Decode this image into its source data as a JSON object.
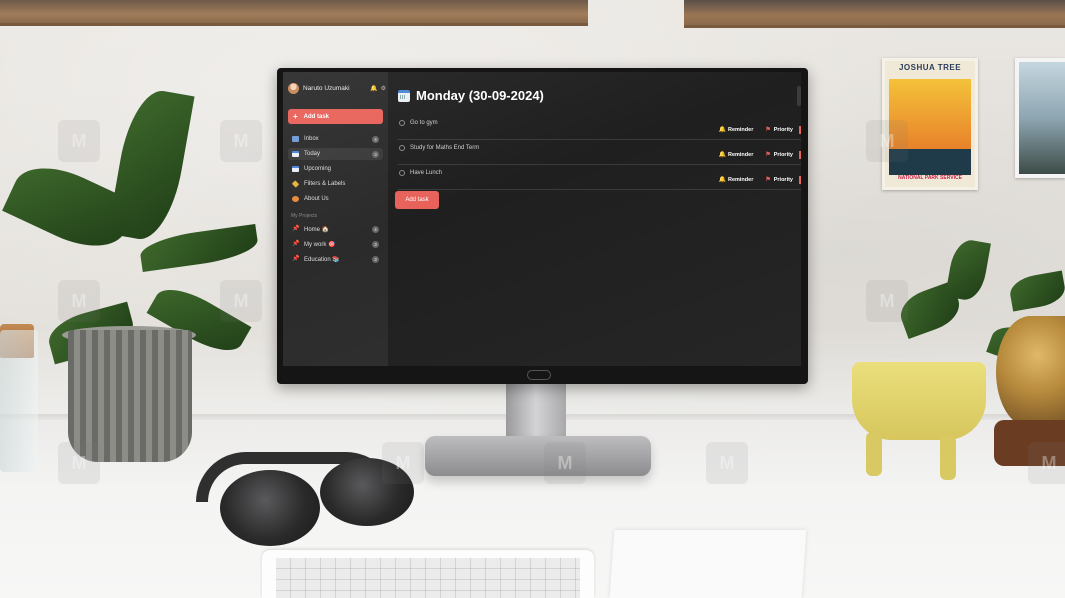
{
  "user": {
    "name": "Naruto Uzumaki"
  },
  "sidebar": {
    "add_task_label": "Add task",
    "nav": [
      {
        "label": "Inbox",
        "icon": "inbox-icon",
        "count": "4"
      },
      {
        "label": "Today",
        "icon": "calendar-today-icon",
        "count": "3",
        "active": true
      },
      {
        "label": "Upcoming",
        "icon": "calendar-upcoming-icon"
      },
      {
        "label": "Filters & Labels",
        "icon": "tag-icon"
      },
      {
        "label": "About Us",
        "icon": "people-icon"
      }
    ],
    "projects_heading": "My Projects",
    "projects": [
      {
        "label": "Home 🏠",
        "count": "4"
      },
      {
        "label": "My work 🎯",
        "count": "3"
      },
      {
        "label": "Education 📚",
        "count": "3"
      }
    ]
  },
  "main": {
    "title": "Monday (30-09-2024)",
    "tasks": [
      {
        "title": "Go to gym",
        "reminder": "Reminder",
        "priority": "Priority"
      },
      {
        "title": "Study for Maths End Term",
        "reminder": "Reminder",
        "priority": "Priority"
      },
      {
        "title": "Have Lunch",
        "reminder": "Reminder",
        "priority": "Priority"
      }
    ],
    "add_task_label": "Add task"
  },
  "colors": {
    "accent": "#e8625a",
    "sidebar_bg": "#2b2b2b",
    "main_bg": "#1f1f1f",
    "reminder_icon": "#f2c230"
  }
}
